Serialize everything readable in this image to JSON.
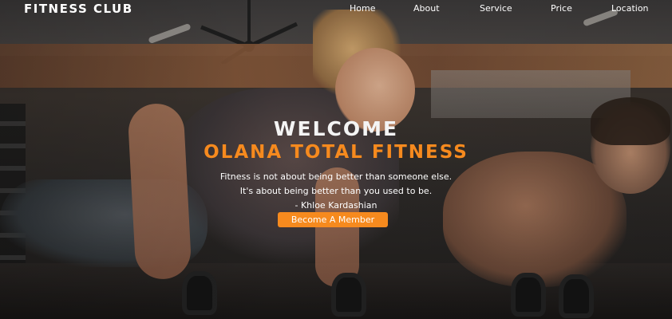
{
  "brand": "FITNESS CLUB",
  "nav": {
    "items": [
      "Home",
      "About",
      "Service",
      "Price",
      "Location"
    ]
  },
  "hero": {
    "welcome": "WELCOME",
    "gym_name": "OLANA TOTAL FITNESS",
    "quote_line1": "Fitness is not about being better than someone else.",
    "quote_line2": "It's about being better than you used to be.",
    "quote_author": "- Khloe Kardashian",
    "cta_label": "Become A Member"
  },
  "colors": {
    "accent": "#f68a1e",
    "text": "#ffffff"
  }
}
